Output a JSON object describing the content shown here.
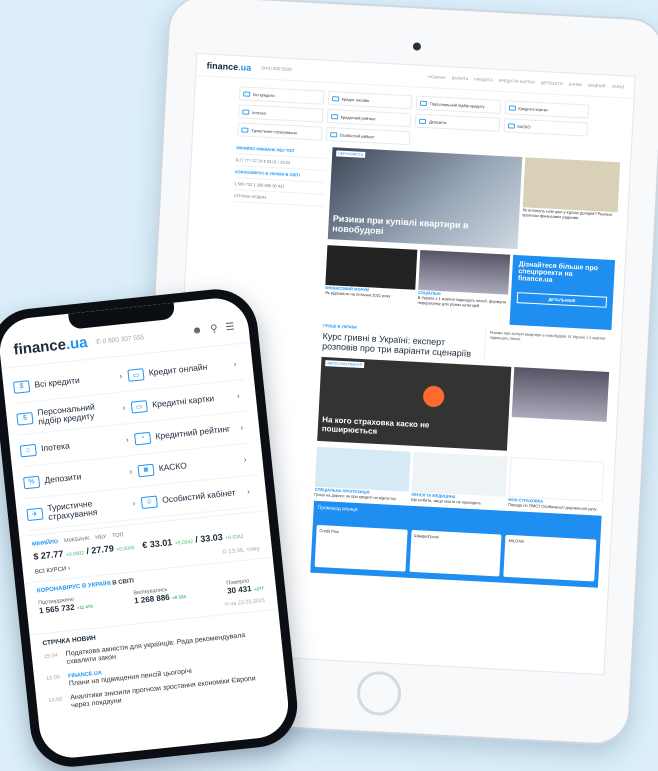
{
  "tablet": {
    "logo": {
      "main": "finance",
      "tld": ".ua"
    },
    "phone": "(044) 500 5500",
    "nav": [
      "НОВИНИ",
      "ВАЛЮТА",
      "КРЕДИТИ",
      "КРЕДИТНІ КАРТКИ",
      "ДЕПОЗИТИ",
      "БАНКИ",
      "ВХІДНИЙ",
      "ЗАРАЗ"
    ],
    "tiles": [
      "Всі кредити",
      "Кредит онлайн",
      "Персональний підбір кредиту",
      "Кредитні картки",
      "Іпотека",
      "Кредитний рейтинг",
      "Депозити",
      "КАСКО",
      "Туристичне страхування",
      "Особистий кабінет"
    ],
    "left": {
      "rate_tabs": "МІНЯЙЛО  МІЖБАНК  НБУ  ТОП",
      "rates": "$ 27.77 / 27.79  € 33.01 / 33.03",
      "covid_title": "КОРОНАВІРУС В УКРАЇНІ  В СВІТІ",
      "covid_vals": "1 565 732   1 268 886   30 431",
      "news_title": "СТРІЧКА НОВИН"
    },
    "hero_tag": "НЕРУХОМІСТЬ",
    "hero_title": "Ризики при купівлі квартири в новобудові",
    "cards": [
      {
        "tag": "ФІНАНСОВИЙ ФОРУМ",
        "text": "Як відповісти на питання 2021 року"
      },
      {
        "tag": "СОЦІАЛЬНІ",
        "text": "В Україні з 1 жовтня підвищать пенсії: формули перерахунку для різних категорій"
      },
      {
        "tag": "РЕКЛАМА",
        "text": "Дізнайтеся більше про спецпропозиції на finance.ua"
      }
    ],
    "side_news": "Як вплинуть нові ціни у курсах доларів? Реальні прогнози фінансових радників",
    "ad_title": "Дізнайтеся більше про спецпроекти на finance.ua",
    "ad_button": "ДЕТАЛЬНІШЕ",
    "quote_tag": "ГРОШІ В УКРАЇНІ",
    "quote": "Курс гривні в Україні: експерт розповів про три варіанти сценаріїв",
    "quote_side": "Ризики при купівлі квартири в новобудові. В Україні з 1 жовтня підвищать пенсії.",
    "hero2_tag": "АВТОСТРАХУВАННЯ",
    "hero2_title": "На кого страховка каско не поширюється",
    "cards2": [
      {
        "tag": "СПЕЦІАЛЬНА ПРОПОЗИЦІЯ",
        "text": "Гроші на дорогу: як при кредиті на відпустку"
      },
      {
        "tag": "ПЕНСІЇ ТА МЕДИЦИНА",
        "text": "Що робити, якщо кошти не приходять"
      },
      {
        "tag": "МОЯ СТРАХОВКА",
        "text": "Порада по ОМС? Особливості дорожнього руху"
      }
    ],
    "promo_title": "Промокод місяця",
    "promo_items": [
      "Credit Plus",
      "ШвидкоГроші",
      "MILOAN"
    ]
  },
  "phone": {
    "logo": {
      "main": "finance",
      "tld": ".ua"
    },
    "phone_number": "0 800 307 555",
    "menu": [
      {
        "icon": "$",
        "label": "Всі кредити"
      },
      {
        "icon": "▭",
        "label": "Кредит онлайн"
      },
      {
        "icon": "$",
        "label": "Персональний підбір кредиту"
      },
      {
        "icon": "▭",
        "label": "Кредитні картки"
      },
      {
        "icon": "⌂",
        "label": "Іпотека"
      },
      {
        "icon": "◔",
        "label": "Кредитний рейтинг"
      },
      {
        "icon": "%",
        "label": "Депозити"
      },
      {
        "icon": "◙",
        "label": "КАСКО"
      },
      {
        "icon": "✈",
        "label": "Туристичне страхування"
      },
      {
        "icon": "☺",
        "label": "Особистий кабінет"
      }
    ],
    "rates": {
      "tabs": [
        "МІНЯЙЛО",
        "МІЖБАНК",
        "НБУ",
        "ТОП"
      ],
      "usd": "$ 27.77",
      "usd_change": "+0.0002",
      "usd_sell": "/ 27.79",
      "usd_sell_change": "+0.0005",
      "eur": "€ 33.01",
      "eur_change": "+0.0342",
      "eur_sell": "/ 33.03",
      "eur_sell_change": "+0.0342",
      "all_rates": "ВСІ КУРСИ ›",
      "time": "© 13:46, тому"
    },
    "covid": {
      "title": "КОРОНАВІРУС В УКРАЇНІ",
      "world": "В СВІТІ",
      "confirmed_label": "Підтверджено",
      "confirmed": "1 565 732",
      "confirmed_delta": "+11 470",
      "recovered_label": "Вилікувались",
      "recovered": "1 268 886",
      "recovered_delta": "+8 334",
      "deaths_label": "Померло",
      "deaths": "30 431",
      "deaths_delta": "+277",
      "date": "© на 23.03.2021"
    },
    "news": {
      "title": "СТРІЧКА НОВИН",
      "items": [
        {
          "time": "15:34",
          "source": "",
          "text": "Податкова амністія для українців: Рада рекомендувала схвалити закон"
        },
        {
          "time": "15:05",
          "source": "FINANCE.UA",
          "text": "Плани на підвищення пенсій цьогорічі"
        },
        {
          "time": "14:58",
          "source": "",
          "text": "Аналітики знизили прогнози зростання економіки Європи через локдауни"
        }
      ]
    }
  }
}
